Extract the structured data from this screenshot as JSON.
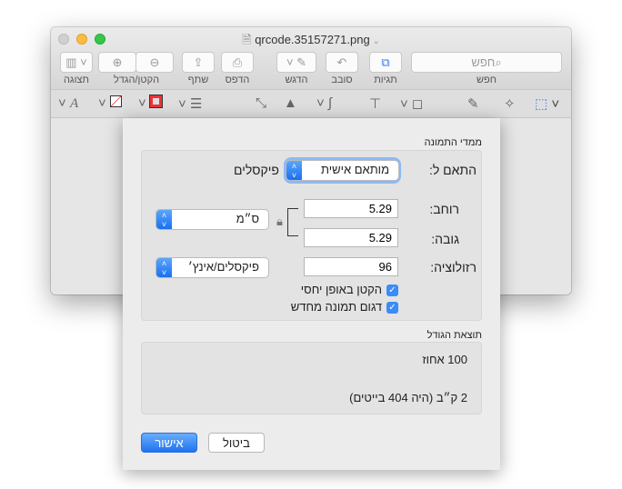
{
  "window": {
    "title": "qrcode.35157271.png"
  },
  "toolbar": {
    "view": "תצוגה",
    "zoom": "הקטן/הגדל",
    "share": "שתף",
    "print": "הדפס",
    "highlight": "הדגש",
    "rotate": "סובב",
    "markup": "תגיות",
    "search_label": "חפש",
    "search_placeholder": "חפש"
  },
  "dialog": {
    "section1_title": "ממדי התמונה",
    "fit_label": "התאם ל:",
    "fit_value": "מותאם אישית",
    "fit_unit": "פיקסלים",
    "width_label": "רוחב:",
    "width_value": "5.29",
    "height_label": "גובה:",
    "height_value": "5.29",
    "unit_value": "ס״מ",
    "resolution_label": "רזולוציה:",
    "resolution_value": "96",
    "resolution_unit": "פיקסלים/אינץ׳",
    "scale_proportionally": "הקטן באופן יחסי",
    "scale_checked": true,
    "resample": "דגום תמונה מחדש",
    "resample_checked": true,
    "section2_title": "תוצאת הגודל",
    "percent": "100 אחוז",
    "size": "2 ק״ב (היה 404 בייטים)",
    "cancel": "ביטול",
    "ok": "אישור"
  },
  "colors": {
    "accent": "#2f7cf6"
  }
}
